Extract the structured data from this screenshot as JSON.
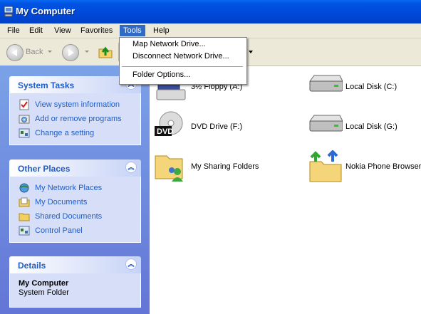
{
  "window": {
    "title": "My Computer",
    "icon": "computer-icon"
  },
  "menubar": [
    "File",
    "Edit",
    "View",
    "Favorites",
    "Tools",
    "Help"
  ],
  "toolbar": {
    "back_label": "Back"
  },
  "tools_menu": {
    "map_network_drive": "Map Network Drive...",
    "disconnect_network_drive": "Disconnect Network Drive...",
    "folder_options": "Folder Options..."
  },
  "system_tasks": {
    "title": "System Tasks",
    "items": [
      "View system information",
      "Add or remove programs",
      "Change a setting"
    ]
  },
  "other_places": {
    "title": "Other Places",
    "items": [
      "My Network Places",
      "My Documents",
      "Shared Documents",
      "Control Panel"
    ]
  },
  "details": {
    "title": "Details",
    "name": "My Computer",
    "type": "System Folder"
  },
  "drives": [
    {
      "label": "3½ Floppy (A:)",
      "icon": "floppy-drive-icon"
    },
    {
      "label": "Local Disk (C:)",
      "icon": "hard-disk-icon"
    },
    {
      "label": "DVD Drive (F:)",
      "icon": "dvd-drive-icon"
    },
    {
      "label": "Local Disk (G:)",
      "icon": "hard-disk-icon"
    },
    {
      "label": "My Sharing Folders",
      "icon": "sharing-folder-icon"
    },
    {
      "label": "Nokia Phone Browser",
      "icon": "phone-browser-icon"
    }
  ],
  "icon_texts": {
    "dvd": "DVD"
  },
  "colors": {
    "title_bar": "#0054e3",
    "menu_highlight": "#316ac5",
    "panel_link": "#215dc6",
    "left_pane": "#7ba2e7"
  }
}
